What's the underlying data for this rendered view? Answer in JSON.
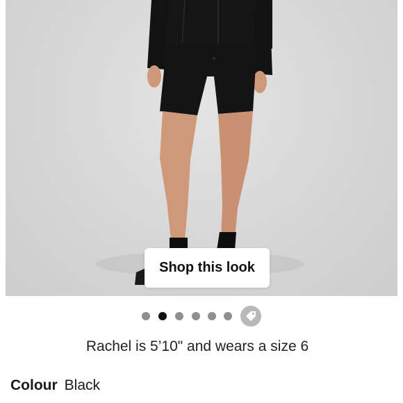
{
  "product_image": {
    "alt": "",
    "shop_button_label": "Shop this look"
  },
  "carousel": {
    "total_images": 6,
    "active_index": 1,
    "extra_icon": "price-tag-icon"
  },
  "model_info": "Rachel is 5’10\" and wears a size 6",
  "colour": {
    "label": "Colour",
    "value": "Black"
  },
  "colors": {
    "background": "#ffffff",
    "dot_inactive": "#8f8f8f",
    "dot_active": "#111111",
    "tag_bg": "#b9b9b9",
    "garment": "#141414",
    "skin": "#cf9878"
  }
}
